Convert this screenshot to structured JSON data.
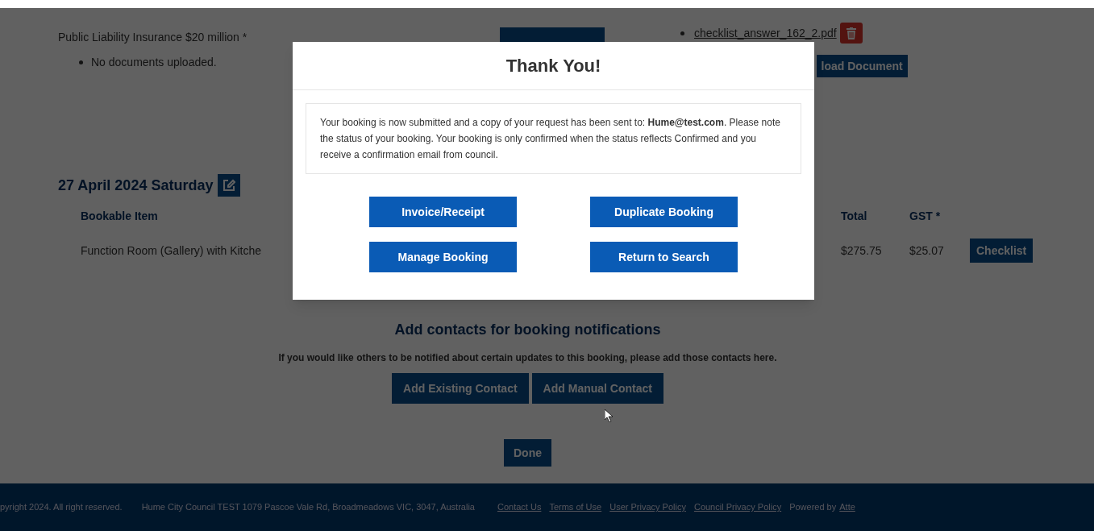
{
  "documents": {
    "label": "Public Liability Insurance $20 million *",
    "status": "No documents uploaded.",
    "file": "checklist_answer_162_2.pdf",
    "upload_button": "load Document"
  },
  "booking": {
    "date": "27 April 2024 Saturday",
    "columns": [
      "Bookable Item",
      "Total",
      "GST *"
    ],
    "rows": [
      {
        "item": "Function Room (Gallery) with Kitche",
        "total": "$275.75",
        "gst": "$25.07",
        "action": "Checklist"
      }
    ]
  },
  "contacts": {
    "title": "Add contacts for booking notifications",
    "text": "If you would like others to be notified about certain updates to this booking, please add those contacts here.",
    "buttons": [
      "Add Existing Contact",
      "Add Manual Contact"
    ]
  },
  "done_button": "Done",
  "footer": {
    "copyright": "pyright 2024. All right reserved.",
    "address": "Hume City Council TEST 1079 Pascoe Vale Rd, Broadmeadows VIC, 3047, Australia",
    "links": [
      "Contact Us",
      "Terms of Use",
      "User Privacy Policy",
      "Council Privacy Policy"
    ],
    "powered": "Powered by",
    "powered_link": "Atte"
  },
  "dialog": {
    "title": "Thank You!",
    "message": "Your booking is now submitted and a copy of your request has been sent to: **Hume@test.com**. Please note the status of your booking. Your booking is only confirmed when the status reflects Confirmed and you receive a confirmation email from council.",
    "buttons": [
      "Invoice/Receipt",
      "Duplicate Booking",
      "Manage Booking",
      "Return to Search"
    ]
  }
}
